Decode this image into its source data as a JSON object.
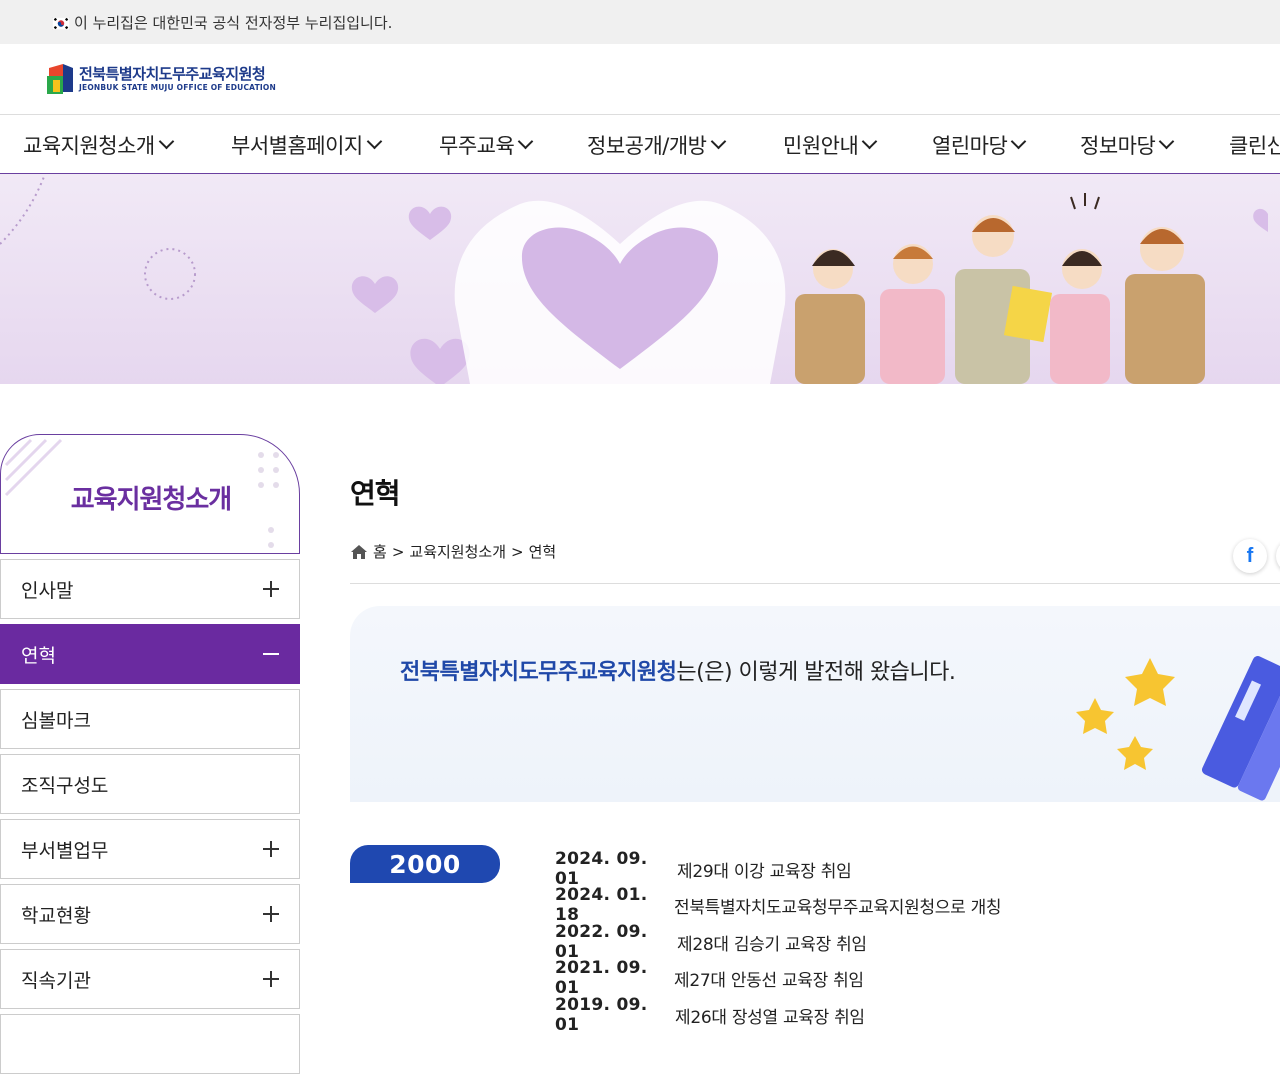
{
  "gov_banner": {
    "text": "이 누리집은 대한민국 공식 전자정부 누리집입니다."
  },
  "logo": {
    "name_ko": "전북특별자치도무주교육지원청",
    "name_en": "JEONBUK STATE MUJU OFFICE OF EDUCATION"
  },
  "gnb": [
    {
      "label": "교육지원청소개"
    },
    {
      "label": "부서별홈페이지"
    },
    {
      "label": "무주교육"
    },
    {
      "label": "정보공개/개방"
    },
    {
      "label": "민원안내"
    },
    {
      "label": "열린마당"
    },
    {
      "label": "정보마당"
    },
    {
      "label": "클린신고"
    }
  ],
  "sidebar": {
    "title": "교육지원청소개",
    "items": [
      {
        "label": "인사말",
        "expand": "plus"
      },
      {
        "label": "연혁",
        "expand": "minus",
        "active": true
      },
      {
        "label": "심볼마크"
      },
      {
        "label": "조직구성도"
      },
      {
        "label": "부서별업무",
        "expand": "plus"
      },
      {
        "label": "학교현황",
        "expand": "plus"
      },
      {
        "label": "직속기관",
        "expand": "plus"
      }
    ]
  },
  "main": {
    "title": "연혁",
    "breadcrumb": {
      "home": "홈",
      "sep": ">",
      "level1": "교육지원청소개",
      "level2": "연혁"
    },
    "share": {
      "facebook": "f"
    },
    "intro": {
      "org": "전북특별자치도무주교육지원청",
      "rest": "는(은) 이렇게 발전해 왔습니다."
    },
    "history": {
      "year": "2000",
      "entries": [
        {
          "date": "2024. 09. 01",
          "desc": "제29대 이강 교육장 취임"
        },
        {
          "date": "2024. 01. 18",
          "desc": "전북특별자치도교육청무주교육지원청으로 개칭"
        },
        {
          "date": "2022. 09. 01",
          "desc": "제28대 김승기 교육장 취임"
        },
        {
          "date": "2021. 09. 01",
          "desc": "제27대 안동선 교육장 취임"
        },
        {
          "date": "2019. 09. 01",
          "desc": "제26대 장성열 교육장 취임"
        }
      ]
    }
  },
  "colors": {
    "brand_purple": "#6a2aa0",
    "brand_blue": "#1f48b0",
    "hero_bg": "#ece0f3"
  }
}
